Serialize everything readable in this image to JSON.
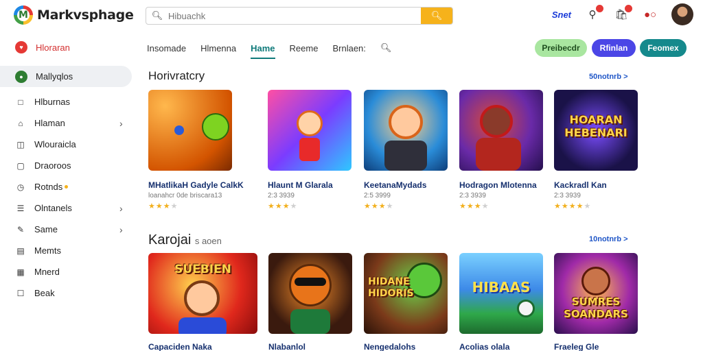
{
  "app": {
    "logo_letter": "M",
    "name": "Markvsphage"
  },
  "search": {
    "placeholder": "Hibuachk"
  },
  "header": {
    "shop_label": "Snet"
  },
  "sidebar": {
    "brand_label": "Hloraran",
    "items": [
      {
        "label": "Mallyqlos",
        "icon": "home-icon",
        "active": true
      },
      {
        "label": "Hlburnas",
        "icon": "folder-icon"
      },
      {
        "label": "Hlaman",
        "icon": "store-icon",
        "chevron": true
      },
      {
        "label": "Wlouraicla",
        "icon": "bag-icon"
      },
      {
        "label": "Draoroos",
        "icon": "tag-icon"
      },
      {
        "label": "Rotnds",
        "icon": "clock-icon",
        "dot": true
      },
      {
        "label": "Olntanels",
        "icon": "list-icon",
        "chevron": true
      },
      {
        "label": "Same",
        "icon": "edit-icon",
        "chevron": true
      },
      {
        "label": "Memts",
        "icon": "doc-icon"
      },
      {
        "label": "Mnerd",
        "icon": "chart-icon"
      },
      {
        "label": "Beak",
        "icon": "square-icon"
      }
    ]
  },
  "tabs": [
    "Insomade",
    "Hlmenna",
    "Hame",
    "Reeme",
    "Brnlaen:"
  ],
  "active_tab": "Hame",
  "pills": [
    "Preibecdr",
    "Rfinlan",
    "Feomex"
  ],
  "sections": [
    {
      "title": "Horivratcry",
      "see_all": "50notnrb >",
      "cards": [
        {
          "title": "MHatlikaH Gadyle CalkK",
          "sub": "loanahcr 0de briscara13",
          "rating": 3,
          "art_text": ""
        },
        {
          "title": "Hlaunt M Glarala",
          "sub": "2:3 3939",
          "rating": 3,
          "art_text": ""
        },
        {
          "title": "KeetanaMydads",
          "sub": "2:5 3999",
          "rating": 3,
          "art_text": ""
        },
        {
          "title": "Hodragon Mlotenna",
          "sub": "2:3 3939",
          "rating": 3,
          "art_text": ""
        },
        {
          "title": "Kackradl Kan",
          "sub": "2:3 3939",
          "rating": 4,
          "art_text": "HOARAN HEBENARI"
        }
      ]
    },
    {
      "title": "Karojai",
      "title_suffix": "s aoen",
      "see_all": "10notnrb >",
      "cards": [
        {
          "title": "Capaciden Naka",
          "art_text": "SUEBIEN"
        },
        {
          "title": "Nlabanlol",
          "art_text": ""
        },
        {
          "title": "Nengedalohs",
          "art_text": "HIDANE HIDORIS"
        },
        {
          "title": "Acolias olala",
          "art_text": "HIBAAS"
        },
        {
          "title": "Fraeleg Gle",
          "art_text": "SUMRES SOANDARS"
        }
      ]
    }
  ],
  "colors": {
    "accent_teal": "#0f7a7a",
    "search_button": "#f6b21b",
    "brand_red": "#d32f2f",
    "pill_green": "#a9e6a0",
    "pill_indigo": "#4b46e6",
    "pill_teal": "#15898c",
    "star": "#f2b01e"
  }
}
